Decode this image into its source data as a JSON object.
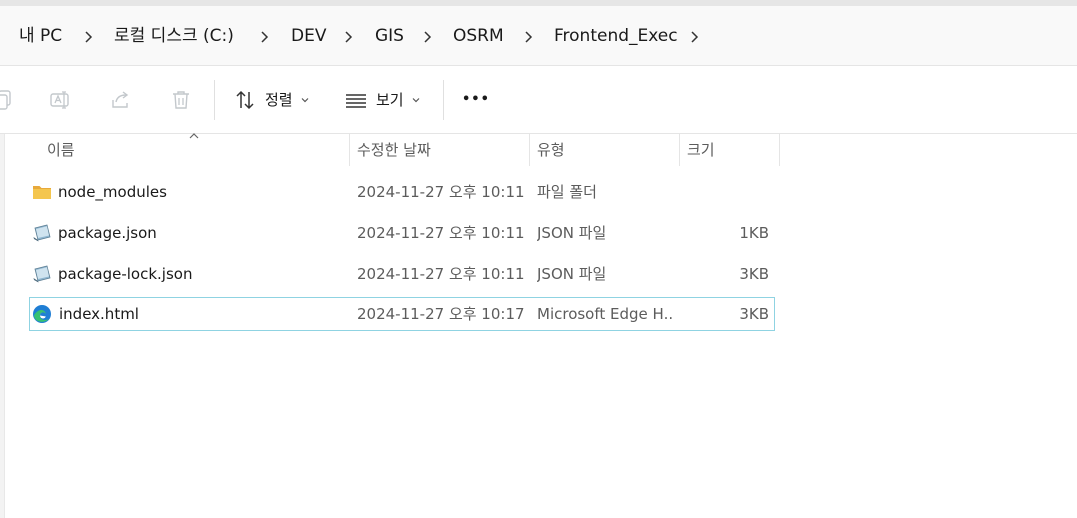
{
  "breadcrumb": {
    "items": [
      "내 PC",
      "로컬 디스크 (C:)",
      "DEV",
      "GIS",
      "OSRM",
      "Frontend_Exec"
    ]
  },
  "toolbar": {
    "icons": [
      "copy-icon",
      "rename-icon",
      "share-icon",
      "delete-icon"
    ],
    "sort_label": "정렬",
    "view_label": "보기",
    "more_label": "•••"
  },
  "columns": {
    "name": "이름",
    "date": "수정한 날짜",
    "type": "유형",
    "size": "크기"
  },
  "files": [
    {
      "name": "node_modules",
      "date": "2024-11-27 오후 10:11",
      "type": "파일 폴더",
      "size": "",
      "icon": "folder-icon"
    },
    {
      "name": "package.json",
      "date": "2024-11-27 오후 10:11",
      "type": "JSON 파일",
      "size": "1KB",
      "icon": "json-file-icon"
    },
    {
      "name": "package-lock.json",
      "date": "2024-11-27 오후 10:11",
      "type": "JSON 파일",
      "size": "3KB",
      "icon": "json-file-icon"
    },
    {
      "name": "index.html",
      "date": "2024-11-27 오후 10:17",
      "type": "Microsoft Edge H...",
      "size": "3KB",
      "icon": "edge-html-icon"
    }
  ],
  "colors": {
    "selection_border": "#8fd3e2",
    "folder": "#f4c64e",
    "edge_blue": "#1f7ed4",
    "edge_green": "#38c172"
  }
}
